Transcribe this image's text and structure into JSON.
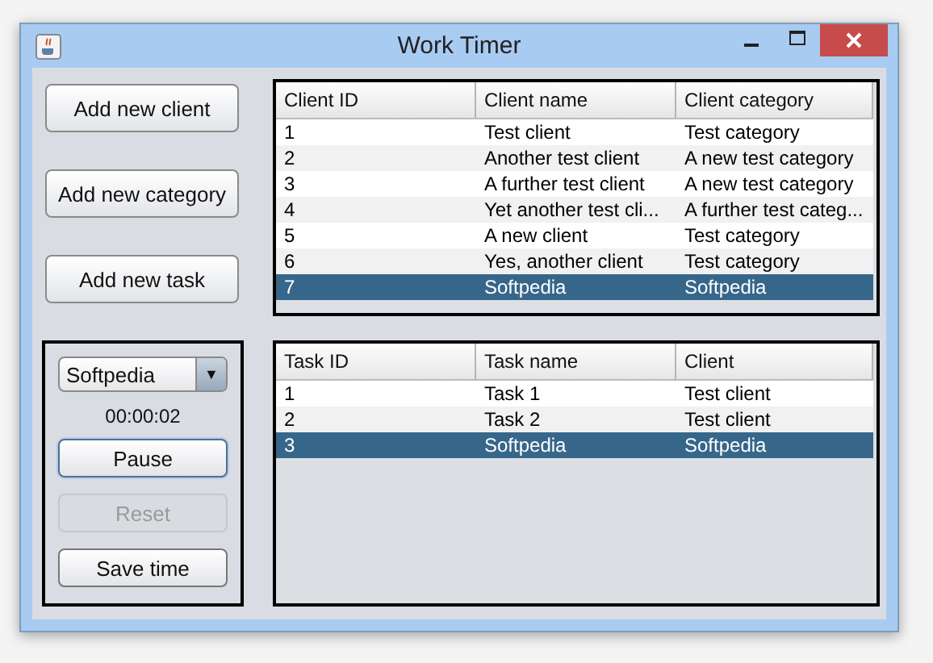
{
  "window": {
    "title": "Work Timer"
  },
  "actions": [
    {
      "label": "Add new client"
    },
    {
      "label": "Add new category"
    },
    {
      "label": "Add new task"
    }
  ],
  "timer": {
    "dropdown": {
      "value": "Softpedia",
      "arrow": "▼"
    },
    "time": "00:00:02",
    "buttons": [
      {
        "label": "Pause",
        "disabled": false,
        "focused": true
      },
      {
        "label": "Reset",
        "disabled": true,
        "focused": false
      },
      {
        "label": "Save time",
        "disabled": false,
        "focused": false
      }
    ]
  },
  "clients_table": {
    "columns": [
      "Client ID",
      "Client name",
      "Client category"
    ],
    "rows": [
      {
        "cells": [
          "1",
          "Test client",
          "Test category"
        ],
        "selected": false
      },
      {
        "cells": [
          "2",
          "Another test client",
          "A new test category"
        ],
        "selected": false
      },
      {
        "cells": [
          "3",
          "A further test client",
          "A new test category"
        ],
        "selected": false
      },
      {
        "cells": [
          "4",
          "Yet another test cli...",
          "A further test categ..."
        ],
        "selected": false
      },
      {
        "cells": [
          "5",
          "A new client",
          "Test category"
        ],
        "selected": false
      },
      {
        "cells": [
          "6",
          "Yes, another client",
          "Test category"
        ],
        "selected": false
      },
      {
        "cells": [
          "7",
          "Softpedia",
          "Softpedia"
        ],
        "selected": true
      }
    ]
  },
  "tasks_table": {
    "columns": [
      "Task ID",
      "Task name",
      "Client"
    ],
    "rows": [
      {
        "cells": [
          "1",
          "Task 1",
          "Test client"
        ],
        "selected": false
      },
      {
        "cells": [
          "2",
          "Task 2",
          "Test client"
        ],
        "selected": false
      },
      {
        "cells": [
          "3",
          "Softpedia",
          "Softpedia"
        ],
        "selected": true
      }
    ]
  }
}
